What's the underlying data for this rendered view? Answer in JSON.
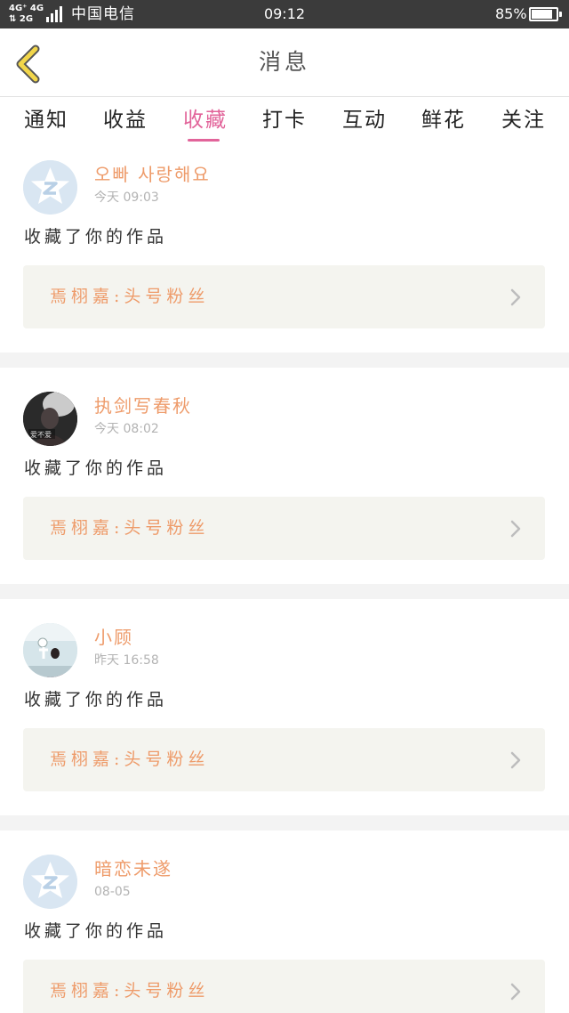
{
  "status_bar": {
    "network_line1": "4G⁺ 4G",
    "network_line2": "⇅ 2G",
    "carrier": "中国电信",
    "time": "09:12",
    "battery_percent": "85%",
    "battery_level": 0.85
  },
  "header": {
    "title": "消息",
    "back_icon": "chevron-left-icon",
    "back_icon_color": "#f2d64a"
  },
  "tabs": [
    {
      "label": "通知",
      "active": false
    },
    {
      "label": "收益",
      "active": false
    },
    {
      "label": "收藏",
      "active": true
    },
    {
      "label": "打卡",
      "active": false
    },
    {
      "label": "互动",
      "active": false
    },
    {
      "label": "鲜花",
      "active": false
    },
    {
      "label": "关注",
      "active": false
    }
  ],
  "colors": {
    "accent_pink": "#e2649a",
    "name_orange": "#ee9b6a",
    "divider_gray": "#f3f3f3"
  },
  "messages": [
    {
      "user_name": "오빠 사랑해요",
      "time": "今天 09:03",
      "avatar": "default-qq-avatar",
      "action": "收藏了你的作品",
      "work_title": "焉栩嘉:头号粉丝"
    },
    {
      "user_name": "执剑写春秋",
      "time": "今天 08:02",
      "avatar": "photo-avatar",
      "avatar_caption": "爱不爱",
      "action": "收藏了你的作品",
      "work_title": "焉栩嘉:头号粉丝"
    },
    {
      "user_name": "小顾",
      "time": "昨天 16:58",
      "avatar": "photo-avatar",
      "action": "收藏了你的作品",
      "work_title": "焉栩嘉:头号粉丝"
    },
    {
      "user_name": "暗恋未遂",
      "time": "08-05",
      "avatar": "default-qq-avatar",
      "action": "收藏了你的作品",
      "work_title": "焉栩嘉:头号粉丝"
    }
  ]
}
